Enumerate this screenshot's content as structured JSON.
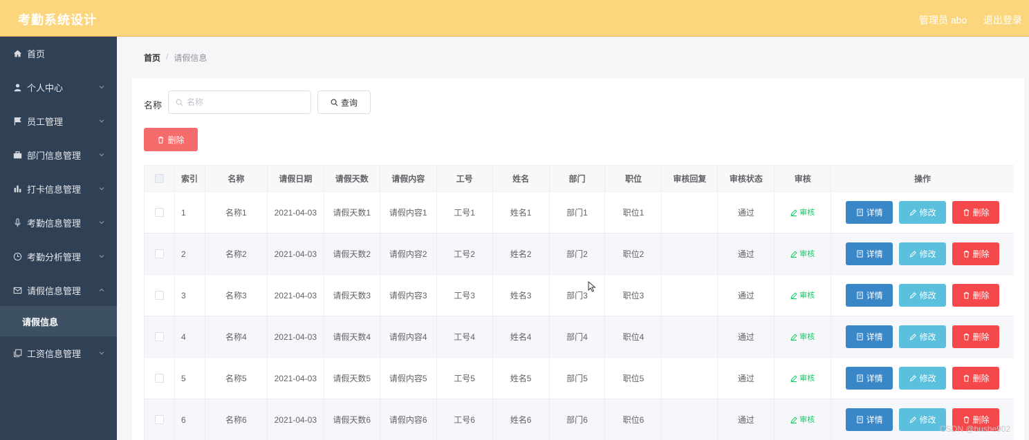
{
  "header": {
    "title": "考勤系统设计",
    "user": "管理员 abo",
    "logout": "退出登录"
  },
  "sidebar": {
    "items": [
      {
        "label": "首页",
        "icon": "home-icon"
      },
      {
        "label": "个人中心",
        "icon": "user-icon"
      },
      {
        "label": "员工管理",
        "icon": "flag-icon"
      },
      {
        "label": "部门信息管理",
        "icon": "briefcase-icon"
      },
      {
        "label": "打卡信息管理",
        "icon": "chart-icon"
      },
      {
        "label": "考勤信息管理",
        "icon": "microphone-icon"
      },
      {
        "label": "考勤分析管理",
        "icon": "clock-icon"
      },
      {
        "label": "请假信息管理",
        "icon": "mail-icon"
      },
      {
        "label": "工资信息管理",
        "icon": "copy-icon"
      }
    ],
    "active_submenu": "请假信息"
  },
  "breadcrumb": {
    "home": "首页",
    "separator": "/",
    "current": "请假信息"
  },
  "search": {
    "label": "名称",
    "placeholder": "名称",
    "value": "",
    "button": "查询"
  },
  "toolbar": {
    "delete_label": "删除"
  },
  "table": {
    "headers": [
      "索引",
      "名称",
      "请假日期",
      "请假天数",
      "请假内容",
      "工号",
      "姓名",
      "部门",
      "职位",
      "审核回复",
      "审核状态",
      "审核",
      "操作"
    ],
    "rows": [
      {
        "index": "1",
        "name": "名称1",
        "date": "2021-04-03",
        "days": "请假天数1",
        "content": "请假内容1",
        "job_no": "工号1",
        "person": "姓名1",
        "dept": "部门1",
        "position": "职位1",
        "reply": "",
        "status": "通过",
        "audit": "审核"
      },
      {
        "index": "2",
        "name": "名称2",
        "date": "2021-04-03",
        "days": "请假天数2",
        "content": "请假内容2",
        "job_no": "工号2",
        "person": "姓名2",
        "dept": "部门2",
        "position": "职位2",
        "reply": "",
        "status": "通过",
        "audit": "审核"
      },
      {
        "index": "3",
        "name": "名称3",
        "date": "2021-04-03",
        "days": "请假天数3",
        "content": "请假内容3",
        "job_no": "工号3",
        "person": "姓名3",
        "dept": "部门3",
        "position": "职位3",
        "reply": "",
        "status": "通过",
        "audit": "审核"
      },
      {
        "index": "4",
        "name": "名称4",
        "date": "2021-04-03",
        "days": "请假天数4",
        "content": "请假内容4",
        "job_no": "工号4",
        "person": "姓名4",
        "dept": "部门4",
        "position": "职位4",
        "reply": "",
        "status": "通过",
        "audit": "审核"
      },
      {
        "index": "5",
        "name": "名称5",
        "date": "2021-04-03",
        "days": "请假天数5",
        "content": "请假内容5",
        "job_no": "工号5",
        "person": "姓名5",
        "dept": "部门5",
        "position": "职位5",
        "reply": "",
        "status": "通过",
        "audit": "审核"
      },
      {
        "index": "6",
        "name": "名称6",
        "date": "2021-04-03",
        "days": "请假天数6",
        "content": "请假内容6",
        "job_no": "工号6",
        "person": "姓名6",
        "dept": "部门6",
        "position": "职位6",
        "reply": "",
        "status": "通过",
        "audit": "审核"
      }
    ],
    "actions": {
      "detail": "详情",
      "edit": "修改",
      "delete": "删除"
    }
  },
  "watermark": "CSDN @bushe902",
  "colors": {
    "header": "#fcd67c",
    "sidebar": "#304156",
    "danger": "#f56c6c",
    "primary": "#3a87c8",
    "info": "#5bc0de",
    "success": "#13ce66"
  }
}
